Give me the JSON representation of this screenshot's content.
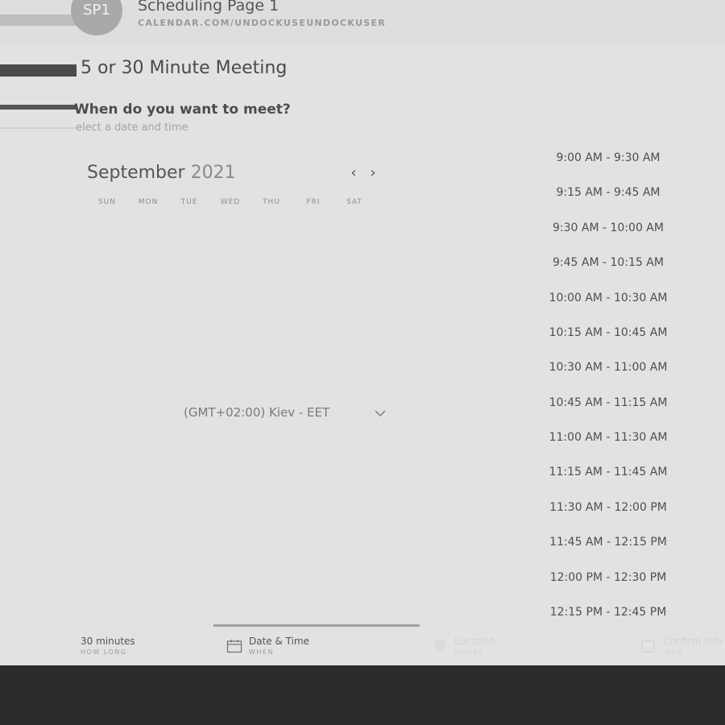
{
  "header": {
    "avatar_initials": "SP1",
    "title": "Scheduling Page 1",
    "url": "CALENDAR.COM/UNDOCKUSEUNDOCKUSER"
  },
  "event": {
    "title": "5 or 30 Minute Meeting",
    "question": "When do you want to meet?",
    "subtitle": "elect a date and time"
  },
  "calendar": {
    "month": "September",
    "year": "2021",
    "prev_icon": "chevron-left-icon",
    "next_icon": "chevron-right-icon",
    "weekdays": [
      "SUN",
      "MON",
      "TUE",
      "WED",
      "THU",
      "FRI",
      "SAT"
    ]
  },
  "timezone": {
    "value": "(GMT+02:00) Kiev - EET",
    "icon": "chevron-down-icon"
  },
  "slots": [
    "9:00 AM - 9:30 AM",
    "9:15 AM - 9:45 AM",
    "9:30 AM - 10:00 AM",
    "9:45 AM - 10:15 AM",
    "10:00 AM - 10:30 AM",
    "10:15 AM - 10:45 AM",
    "10:30 AM - 11:00 AM",
    "10:45 AM - 11:15 AM",
    "11:00 AM - 11:30 AM",
    "11:15 AM - 11:45 AM",
    "11:30 AM - 12:00 PM",
    "11:45 AM - 12:15 PM",
    "12:00 PM - 12:30 PM",
    "12:15 PM - 12:45 PM"
  ],
  "steps": [
    {
      "label": "30 minutes",
      "sub": "HOW LONG"
    },
    {
      "label": "Date & Time",
      "sub": "WHEN",
      "icon": "calendar-icon"
    },
    {
      "label": "Location",
      "sub": "WHERE",
      "icon": "location-pin-icon"
    },
    {
      "label": "Confirm Info",
      "sub": "INFO",
      "icon": "checkbox-icon"
    }
  ]
}
